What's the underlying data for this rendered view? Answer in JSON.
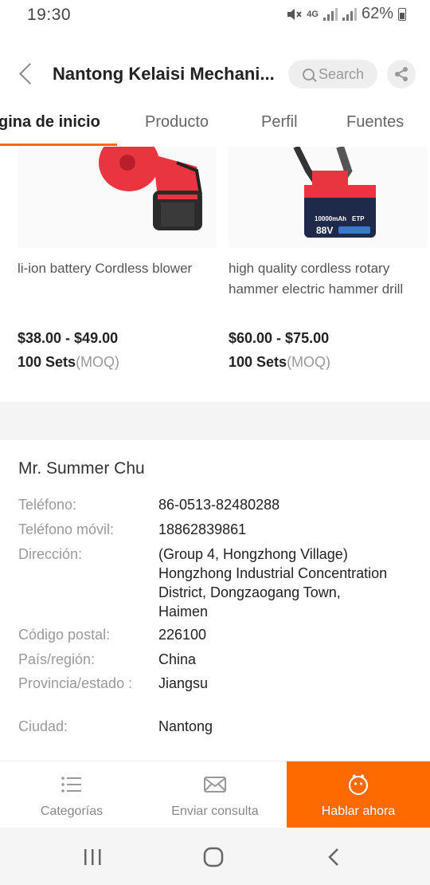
{
  "status_bar": {
    "time": "19:30",
    "network": "4G",
    "battery": "62%"
  },
  "header": {
    "title": "Nantong Kelaisi Mechani...",
    "search_label": "Search"
  },
  "tabs": [
    {
      "label": "gina de inicio"
    },
    {
      "label": "Producto"
    },
    {
      "label": "Perfil"
    },
    {
      "label": "Fuentes"
    }
  ],
  "products": [
    {
      "name": "li-ion battery Cordless blower",
      "price": "$38.00 - $49.00",
      "moq_qty": "100 Sets",
      "moq_suffix": "(MOQ)"
    },
    {
      "name": "high quality cordless rotary hammer electric hammer drill",
      "price": "$60.00 - $75.00",
      "moq_qty": "100 Sets",
      "moq_suffix": "(MOQ)",
      "battery_text_1": "10000mAh",
      "battery_text_2": "88V",
      "battery_brand": "ETP"
    }
  ],
  "contact": {
    "name": "Mr. Summer Chu",
    "rows": [
      {
        "label": "Teléfono:",
        "value": "86-0513-82480288"
      },
      {
        "label": "Teléfono móvil:",
        "value": "18862839861"
      },
      {
        "label": "Dirección:",
        "value": "(Group 4, Hongzhong Village) Hongzhong Industrial Concentration District, Dongzaogang Town, Haimen"
      },
      {
        "label": "Código postal:",
        "value": "226100"
      },
      {
        "label": "País/región:",
        "value": "China"
      },
      {
        "label": "Provincia/estado :",
        "value": "Jiangsu"
      },
      {
        "label": "Ciudad:",
        "value": "Nantong"
      }
    ]
  },
  "action_bar": {
    "categories": "Categorías",
    "inquiry": "Enviar consulta",
    "chat": "Hablar ahora"
  },
  "colors": {
    "accent": "#ff6a00",
    "product_red": "#e8353f"
  }
}
